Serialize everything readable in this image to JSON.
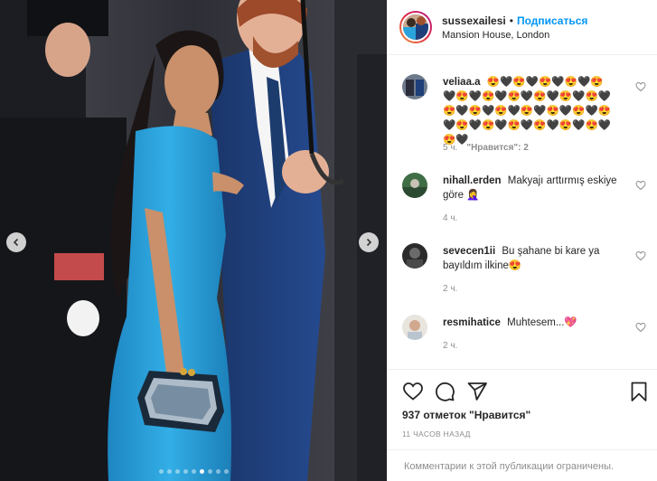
{
  "post": {
    "username": "sussexailesi",
    "separator": "•",
    "follow_label": "Подписаться",
    "location": "Mansion House, London",
    "carousel": {
      "total": 9,
      "active": 6
    }
  },
  "comments": [
    {
      "username": "veliaa.a",
      "text": "😍🖤😍🖤😍🖤😍🖤😍🖤😍🖤😍🖤😍🖤😍🖤😍🖤😍🖤😍🖤😍🖤😍🖤😍🖤😍🖤😍🖤😍🖤😍🖤😍🖤😍🖤😍🖤😍🖤😍🖤😍🖤",
      "time": "5 ч.",
      "likes": "\"Нравится\": 2"
    },
    {
      "username": "nihall.erden",
      "text": "Makyajı arttırmış eskiye göre 🤦‍♀️",
      "time": "4 ч.",
      "likes": ""
    },
    {
      "username": "sevecen1ii",
      "text": "Bu şahane bi kare ya bayıldım ilkine😍",
      "time": "2 ч.",
      "likes": ""
    },
    {
      "username": "resmihatice",
      "text": "Muhtesem...💖",
      "time": "2 ч.",
      "likes": ""
    }
  ],
  "actions": {
    "like_icon": "heart-outline-icon",
    "comment_icon": "comment-bubble-icon",
    "share_icon": "paper-plane-icon",
    "save_icon": "bookmark-icon",
    "likes_text": "937 отметок \"Нравится\"",
    "time_ago": "11 ЧАСОВ НАЗАД",
    "restricted_text": "Комментарии к этой публикации ограничены."
  },
  "colors": {
    "accent": "#0095f6",
    "muted": "#8e8e8e",
    "dress": "#2aa3dc",
    "suit": "#1f3f7a"
  }
}
